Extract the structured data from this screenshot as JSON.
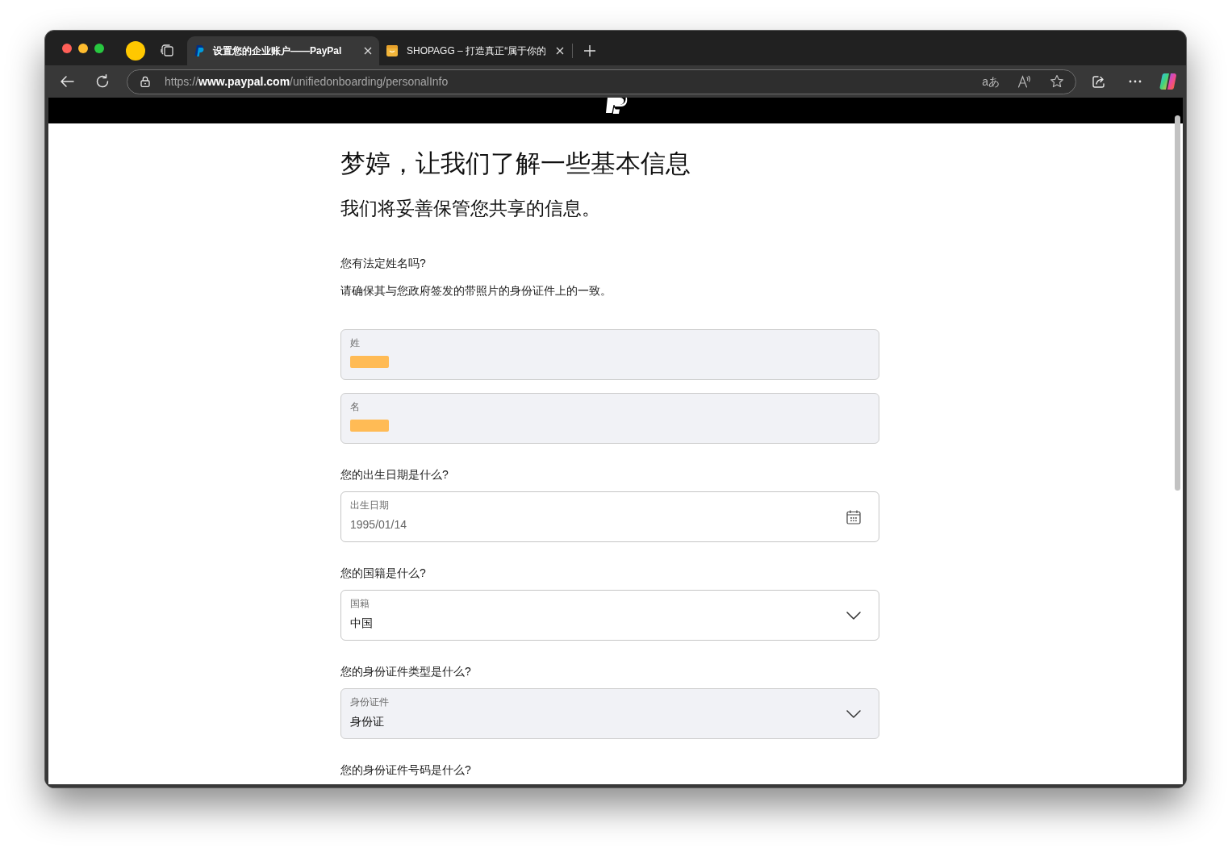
{
  "browser": {
    "tabs": [
      {
        "kind": "p_logo",
        "title": "设置您的企业账户——PayPal",
        "selected": true
      },
      {
        "kind": "bag",
        "title": "SHOPAGG – 打造真正“属于你的",
        "selected": false
      }
    ],
    "address_bar": {
      "url": "https://**www.paypal.com**/unifiedonboarding/personalInfo",
      "translate_label": "aあ"
    }
  },
  "page": {
    "heading": "梦婷，让我们了解一些基本信息",
    "subheading": "我们将妥善保管您共享的信息。",
    "form": [
      {
        "kind": "question",
        "text": "您有法定姓名吗?"
      },
      {
        "kind": "hint",
        "text": "请确保其与您政府签发的带照片的身份证件上的一致。"
      },
      {
        "kind": "text_field",
        "label": "姓",
        "redacted": true,
        "disabled": true
      },
      {
        "kind": "text_field",
        "label": "名",
        "redacted": true,
        "disabled": true
      },
      {
        "kind": "question",
        "text": "您的出生日期是什么?"
      },
      {
        "kind": "date_field",
        "label": "出生日期",
        "value": "1995/01/14",
        "disabled": false
      },
      {
        "kind": "question",
        "text": "您的国籍是什么?"
      },
      {
        "kind": "select_field",
        "label": "国籍",
        "value": "中国",
        "disabled": false
      },
      {
        "kind": "question",
        "text": "您的身份证件类型是什么?"
      },
      {
        "kind": "select_field",
        "label": "身份证件",
        "value": "身份证",
        "disabled": true
      },
      {
        "kind": "question",
        "text": "您的身份证件号码是什么?"
      }
    ]
  }
}
